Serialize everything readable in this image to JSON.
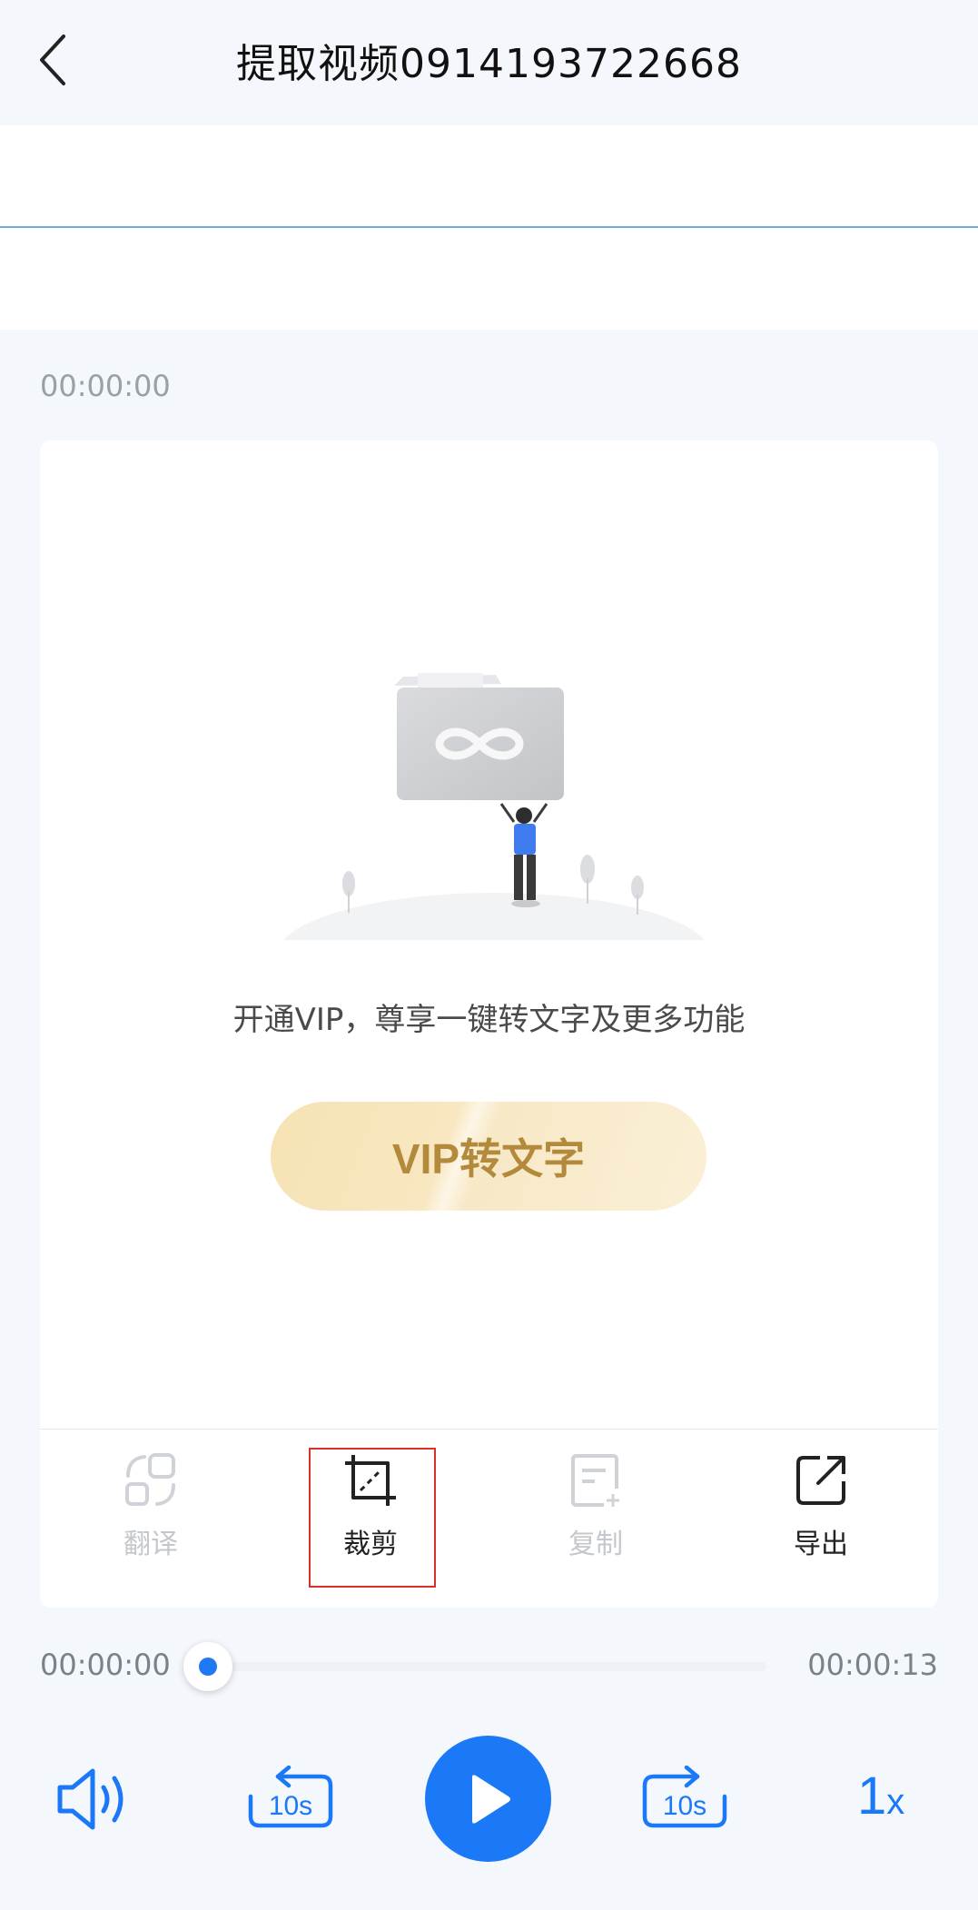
{
  "header": {
    "title": "提取视频0914193722668"
  },
  "timestamp_top": "00:00:00",
  "card": {
    "promo_text": "开通VIP，尊享一键转文字及更多功能",
    "vip_button_label": "VIP转文字"
  },
  "tools": [
    {
      "label": "翻译",
      "icon": "translate-icon",
      "enabled": false
    },
    {
      "label": "裁剪",
      "icon": "crop-icon",
      "enabled": true
    },
    {
      "label": "复制",
      "icon": "copy-icon",
      "enabled": false
    },
    {
      "label": "导出",
      "icon": "export-icon",
      "enabled": true
    }
  ],
  "player": {
    "current_time": "00:00:00",
    "total_time": "00:00:13",
    "progress": 0,
    "rewind_label": "10s",
    "forward_label": "10s",
    "speed_value": "1",
    "speed_unit": "x"
  },
  "colors": {
    "accent": "#1b78f6",
    "vip_gold": "#b3893c",
    "highlight": "#d9302c"
  }
}
